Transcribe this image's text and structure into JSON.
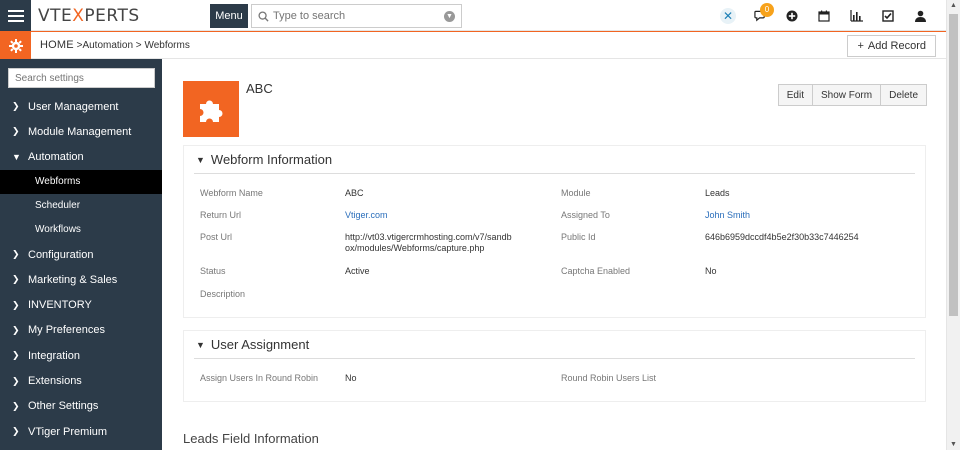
{
  "topbar": {
    "logo_pre": "VTE",
    "logo_x": "X",
    "logo_post": "PERTS",
    "menu_label": "Menu",
    "search_placeholder": "Type to search",
    "notification_count": "0"
  },
  "breadcrumb": {
    "home": "HOME",
    "sep1": " >",
    "level1": "Automation",
    "sep2": " > ",
    "level2": "Webforms"
  },
  "add_record_label": "Add Record",
  "sidebar": {
    "search_placeholder": "Search settings",
    "items": [
      {
        "label": "User Management",
        "expanded": false
      },
      {
        "label": "Module Management",
        "expanded": false
      },
      {
        "label": "Automation",
        "expanded": true
      }
    ],
    "sub_items": [
      {
        "label": "Webforms",
        "active": true
      },
      {
        "label": "Scheduler",
        "active": false
      },
      {
        "label": "Workflows",
        "active": false
      }
    ],
    "items_after": [
      {
        "label": "Configuration"
      },
      {
        "label": "Marketing & Sales"
      },
      {
        "label": "INVENTORY"
      },
      {
        "label": "My Preferences"
      },
      {
        "label": "Integration"
      },
      {
        "label": "Extensions"
      },
      {
        "label": "Other Settings"
      },
      {
        "label": "VTiger Premium"
      }
    ]
  },
  "record": {
    "name": "ABC",
    "actions": {
      "edit": "Edit",
      "show_form": "Show Form",
      "delete": "Delete"
    }
  },
  "webform_info": {
    "title": "Webform Information",
    "webform_name_label": "Webform Name",
    "webform_name_value": "ABC",
    "module_label": "Module",
    "module_value": "Leads",
    "return_url_label": "Return Url",
    "return_url_value": "Vtiger.com",
    "assigned_to_label": "Assigned To",
    "assigned_to_value": "John Smith",
    "post_url_label": "Post Url",
    "post_url_line1": "http://vt03.vtigercrmhosting.com/v7/sandb",
    "post_url_line2": "ox/modules/Webforms/capture.php",
    "public_id_label": "Public Id",
    "public_id_value": "646b6959dccdf4b5e2f30b33c7446254",
    "status_label": "Status",
    "status_value": "Active",
    "captcha_label": "Captcha Enabled",
    "captcha_value": "No",
    "description_label": "Description"
  },
  "user_assignment": {
    "title": "User Assignment",
    "round_robin_label": "Assign Users In Round Robin",
    "round_robin_value": "No",
    "rr_users_label": "Round Robin Users List"
  },
  "leads_section_title": "Leads Field Information"
}
